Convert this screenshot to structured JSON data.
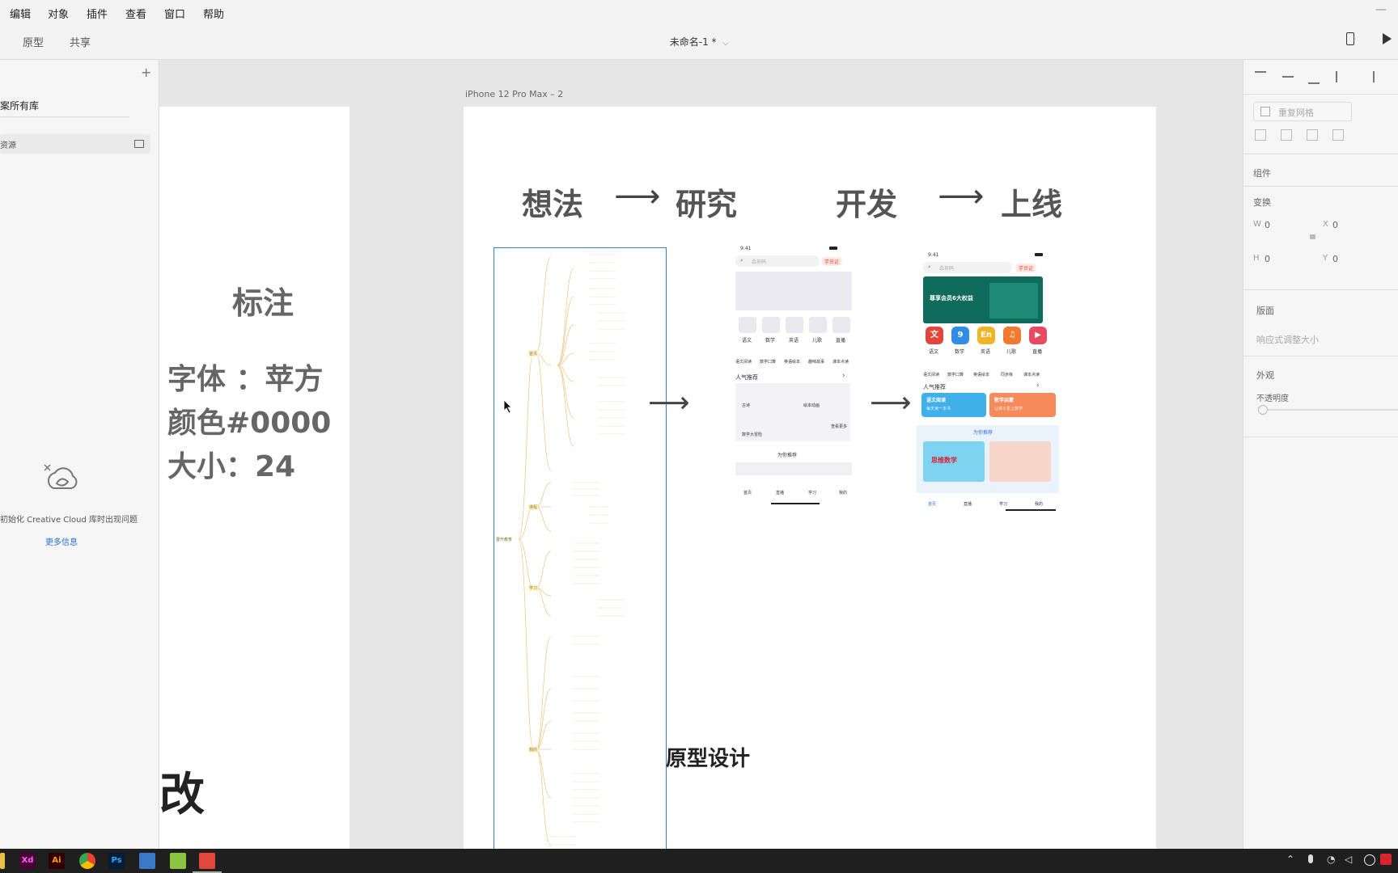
{
  "menubar": {
    "items": [
      "编辑",
      "对象",
      "插件",
      "查看",
      "窗口",
      "帮助"
    ],
    "minimize": "—"
  },
  "toolbar": {
    "tabs": [
      "原型",
      "共享"
    ],
    "doc_title": "未命名-1 *"
  },
  "leftpanel": {
    "library_title": "案所有库",
    "resource_item": "资源",
    "error_text": "初始化 Creative Cloud 库时出现问题",
    "more_info": "更多信息"
  },
  "canvas": {
    "label_board": {
      "title": "标注",
      "font_line": "字体 ：苹方",
      "color_line": "颜色#0000",
      "size_line": "大小：24",
      "bottom_big": "改"
    },
    "iphone_board": {
      "name": "iPhone 12 Pro Max – 2",
      "steps": [
        "想法",
        "研究",
        "开发",
        "上线"
      ],
      "bottom_heading": "原型设计"
    },
    "mindmap": {
      "root": "晋升教育",
      "branches": [
        "首页",
        "课程",
        "学习",
        "我的"
      ]
    },
    "phone1": {
      "time": "9:41",
      "search": "会员码",
      "vip": "学员证",
      "icons": [
        "语文",
        "数学",
        "英语",
        "儿歌",
        "直播"
      ],
      "icons2": [
        "语文阅读",
        "数学口算",
        "英语绘本",
        "趣味故事",
        "课本点读"
      ],
      "section": "人气推荐",
      "cards": [
        "古诗",
        "绘本动画",
        "数学大冒险",
        "查看更多"
      ],
      "recommend": "为你推荐",
      "tabs": [
        "首页",
        "直播",
        "学习",
        "我的"
      ]
    },
    "phone2": {
      "time": "9:41",
      "search": "会员码",
      "vip": "学员证",
      "banner": "尊享会员6大权益",
      "icons": [
        "语文",
        "数学",
        "英语",
        "儿歌",
        "直播"
      ],
      "icon_glyphs": [
        "文",
        "9",
        "En",
        "♫",
        "▶"
      ],
      "icon_colors": [
        "#e2463b",
        "#2f8de4",
        "#f0b429",
        "#f07a2f",
        "#e84a5f"
      ],
      "icons2": [
        "语文阅读",
        "数学口算",
        "英语绘本",
        "同步练",
        "课本点读"
      ],
      "section": "人气推荐",
      "card_left": "语文阅读",
      "card_left_sub": "每天读一本书",
      "card_right": "数学启蒙",
      "card_right_sub": "让孩子爱上数学",
      "recommend": "为你推荐",
      "thumb1": "思维数学",
      "tabs": [
        "首页",
        "直播",
        "学习",
        "我的"
      ]
    }
  },
  "rightpanel": {
    "repeat_grid": "重复网格",
    "component": "组件",
    "transform": "变换",
    "w_label": "W",
    "w_value": "0",
    "x_label": "X",
    "x_value": "0",
    "h_label": "H",
    "h_value": "0",
    "y_label": "Y",
    "y_value": "0",
    "layout": "版面",
    "responsive": "响应式调整大小",
    "appearance": "外观",
    "opacity": "不透明度"
  },
  "taskbar": {
    "apps": [
      "Xd",
      "Ai",
      "Ps"
    ]
  },
  "colors": {
    "accent_blue": "#2f6fd6",
    "xd": "#470137",
    "ai": "#330000",
    "ps": "#001e36"
  }
}
